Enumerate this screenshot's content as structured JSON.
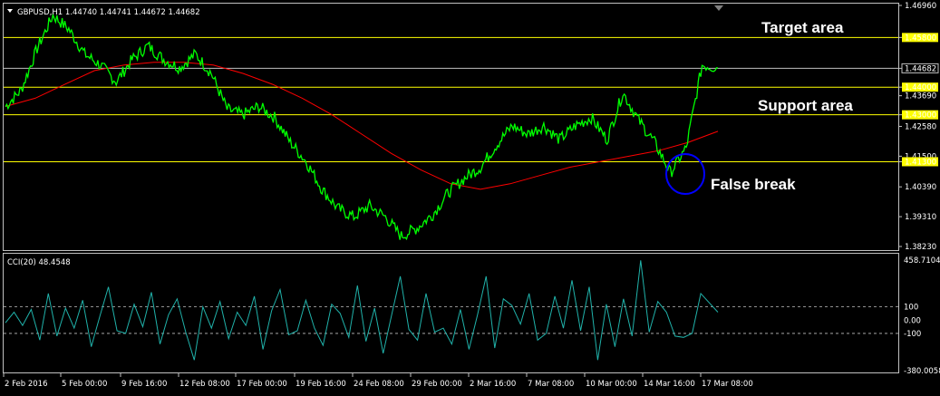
{
  "header": {
    "symbol_info": "GBPUSD,H1  1.44740 1.44741 1.44672 1.44682"
  },
  "indicator": {
    "label": "CCI(20) 48.4548"
  },
  "colors": {
    "background": "#000000",
    "price_line": "#00ff00",
    "ma_line": "#ff0000",
    "cci_line": "#20b2aa",
    "level_line": "#ffff00",
    "current_price_line": "#c0c0c0",
    "frame": "#c0c0c0",
    "highlight_label_bg": "#ffff00",
    "circle": "#0000ff"
  },
  "chart_data": [
    {
      "type": "line",
      "title": "GBPUSD,H1",
      "x": [
        "2 Feb 2016",
        "5 Feb 00:00",
        "9 Feb 16:00",
        "12 Feb 08:00",
        "17 Feb 00:00",
        "19 Feb 16:00",
        "24 Feb 08:00",
        "29 Feb 00:00",
        "2 Mar 16:00",
        "7 Mar 08:00",
        "10 Mar 00:00",
        "14 Mar 16:00",
        "17 Mar 08:00"
      ],
      "ylim": [
        1.3823,
        1.4696
      ],
      "y_ticks": [
        "1.46960",
        "1.45800",
        "1.44682",
        "1.44000",
        "1.43690",
        "1.43000",
        "1.42580",
        "1.41500",
        "1.41300",
        "1.40390",
        "1.39310",
        "1.38230"
      ],
      "highlighted_ticks": [
        "1.45800",
        "1.44000",
        "1.43000",
        "1.41300"
      ],
      "current_price": 1.44682,
      "horizontal_levels": [
        1.458,
        1.44,
        1.43,
        1.413
      ],
      "series": [
        {
          "name": "price",
          "values": [
            1.433,
            1.439,
            1.454,
            1.466,
            1.461,
            1.452,
            1.448,
            1.442,
            1.45,
            1.455,
            1.45,
            1.447,
            1.452,
            1.445,
            1.432,
            1.43,
            1.433,
            1.429,
            1.42,
            1.413,
            1.403,
            1.396,
            1.393,
            1.397,
            1.393,
            1.386,
            1.389,
            1.394,
            1.402,
            1.407,
            1.411,
            1.419,
            1.426,
            1.423,
            1.426,
            1.421,
            1.426,
            1.429,
            1.421,
            1.438,
            1.428,
            1.42,
            1.409,
            1.418,
            1.448,
            1.447
          ]
        },
        {
          "name": "moving_average",
          "values": [
            1.433,
            1.436,
            1.441,
            1.446,
            1.448,
            1.449,
            1.449,
            1.448,
            1.445,
            1.441,
            1.436,
            1.43,
            1.423,
            1.416,
            1.41,
            1.405,
            1.403,
            1.405,
            1.408,
            1.411,
            1.413,
            1.415,
            1.417,
            1.42,
            1.424
          ]
        }
      ],
      "annotations": [
        "Target area",
        "Support area",
        "False break"
      ]
    },
    {
      "type": "line",
      "title": "CCI(20) 48.4548",
      "ylim": [
        -380.0058,
        458.7104
      ],
      "y_ticks": [
        "458.7104",
        "100",
        "0.00",
        "-100",
        "-380.0058"
      ],
      "levels": [
        100,
        -100
      ],
      "series": [
        {
          "name": "CCI",
          "values": [
            -20,
            60,
            -40,
            80,
            -150,
            200,
            -120,
            90,
            -60,
            150,
            -200,
            30,
            250,
            -80,
            -100,
            120,
            -50,
            210,
            -180,
            40,
            160,
            -90,
            -300,
            100,
            -60,
            140,
            -140,
            60,
            -40,
            180,
            -220,
            70,
            230,
            -110,
            -80,
            150,
            -60,
            -190,
            120,
            50,
            -130,
            260,
            -160,
            90,
            -250,
            40,
            330,
            -70,
            -150,
            200,
            -90,
            -60,
            -180,
            80,
            -220,
            40,
            330,
            -210,
            160,
            110,
            -30,
            200,
            -150,
            -100,
            180,
            -60,
            300,
            -80,
            250,
            -300,
            120,
            -200,
            160,
            -120,
            450,
            -90,
            140,
            60,
            -120,
            -130,
            -100,
            200,
            130,
            60
          ]
        }
      ]
    }
  ]
}
